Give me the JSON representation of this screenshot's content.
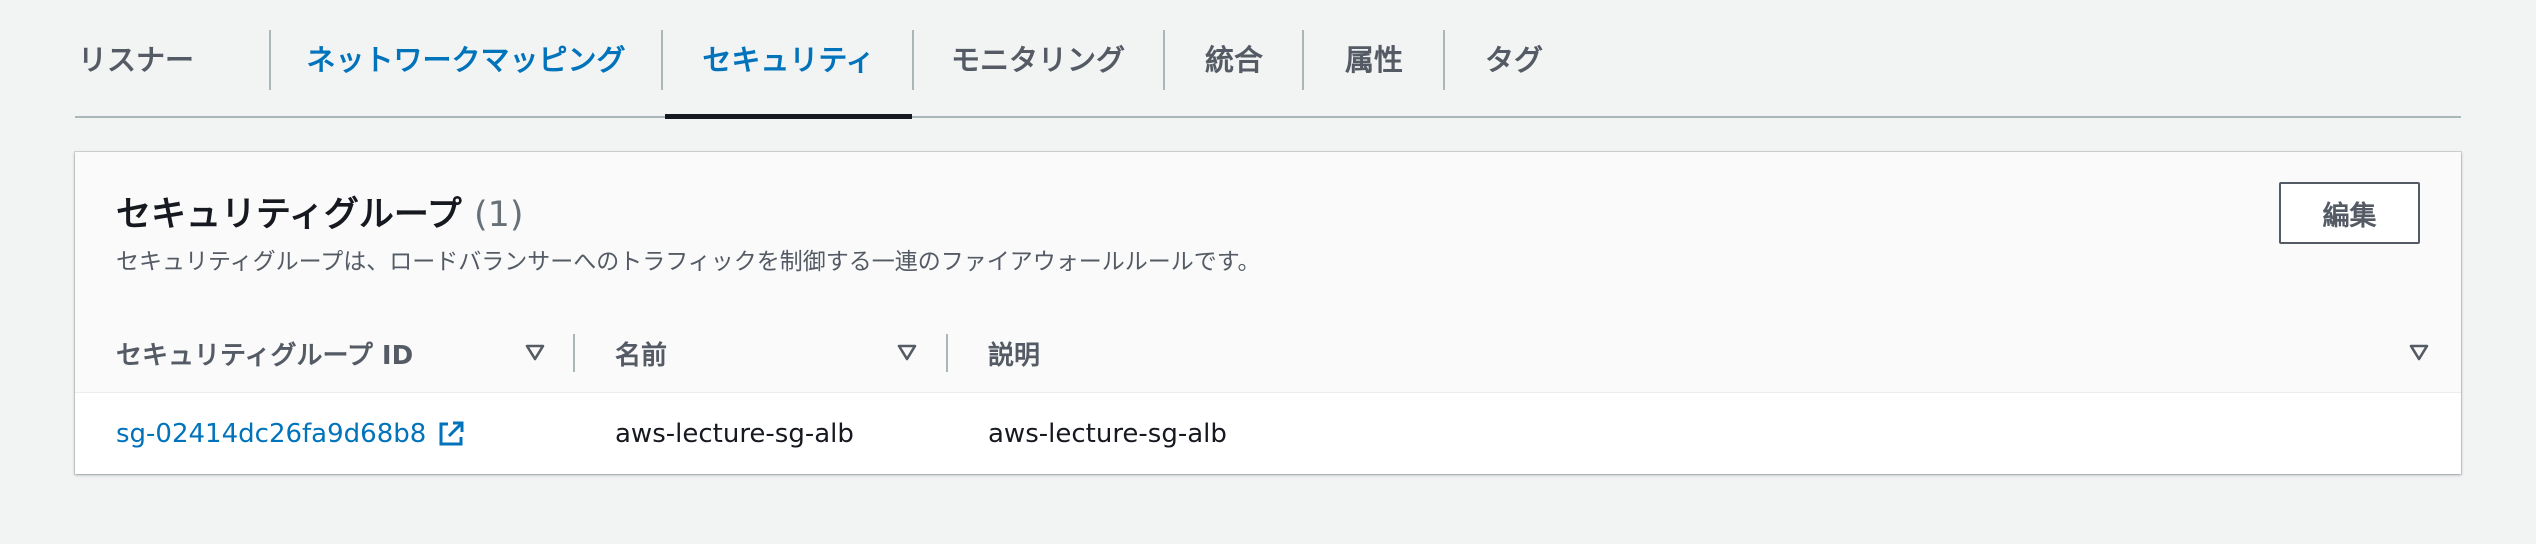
{
  "tabs": [
    {
      "label": "リスナー",
      "state": "normal"
    },
    {
      "label": "ネットワークマッピング",
      "state": "link"
    },
    {
      "label": "セキュリティ",
      "state": "active"
    },
    {
      "label": "モニタリング",
      "state": "normal"
    },
    {
      "label": "統合",
      "state": "normal"
    },
    {
      "label": "属性",
      "state": "normal"
    },
    {
      "label": "タグ",
      "state": "normal"
    }
  ],
  "panel": {
    "title": "セキュリティグループ",
    "count": "(1)",
    "description": "セキュリティグループは、ロードバランサーへのトラフィックを制御する一連のファイアウォールルールです。",
    "edit_label": "編集"
  },
  "table": {
    "columns": [
      "セキュリティグループ ID",
      "名前",
      "説明"
    ],
    "rows": [
      {
        "id": "sg-02414dc26fa9d68b8",
        "name": "aws-lecture-sg-alb",
        "description": "aws-lecture-sg-alb"
      }
    ]
  },
  "colors": {
    "link": "#0073bb",
    "text": "#16191f",
    "muted": "#545b64",
    "background": "#f2f3f3"
  },
  "icons": {
    "sort": "caret-down-icon",
    "external_link": "external-link-icon"
  }
}
